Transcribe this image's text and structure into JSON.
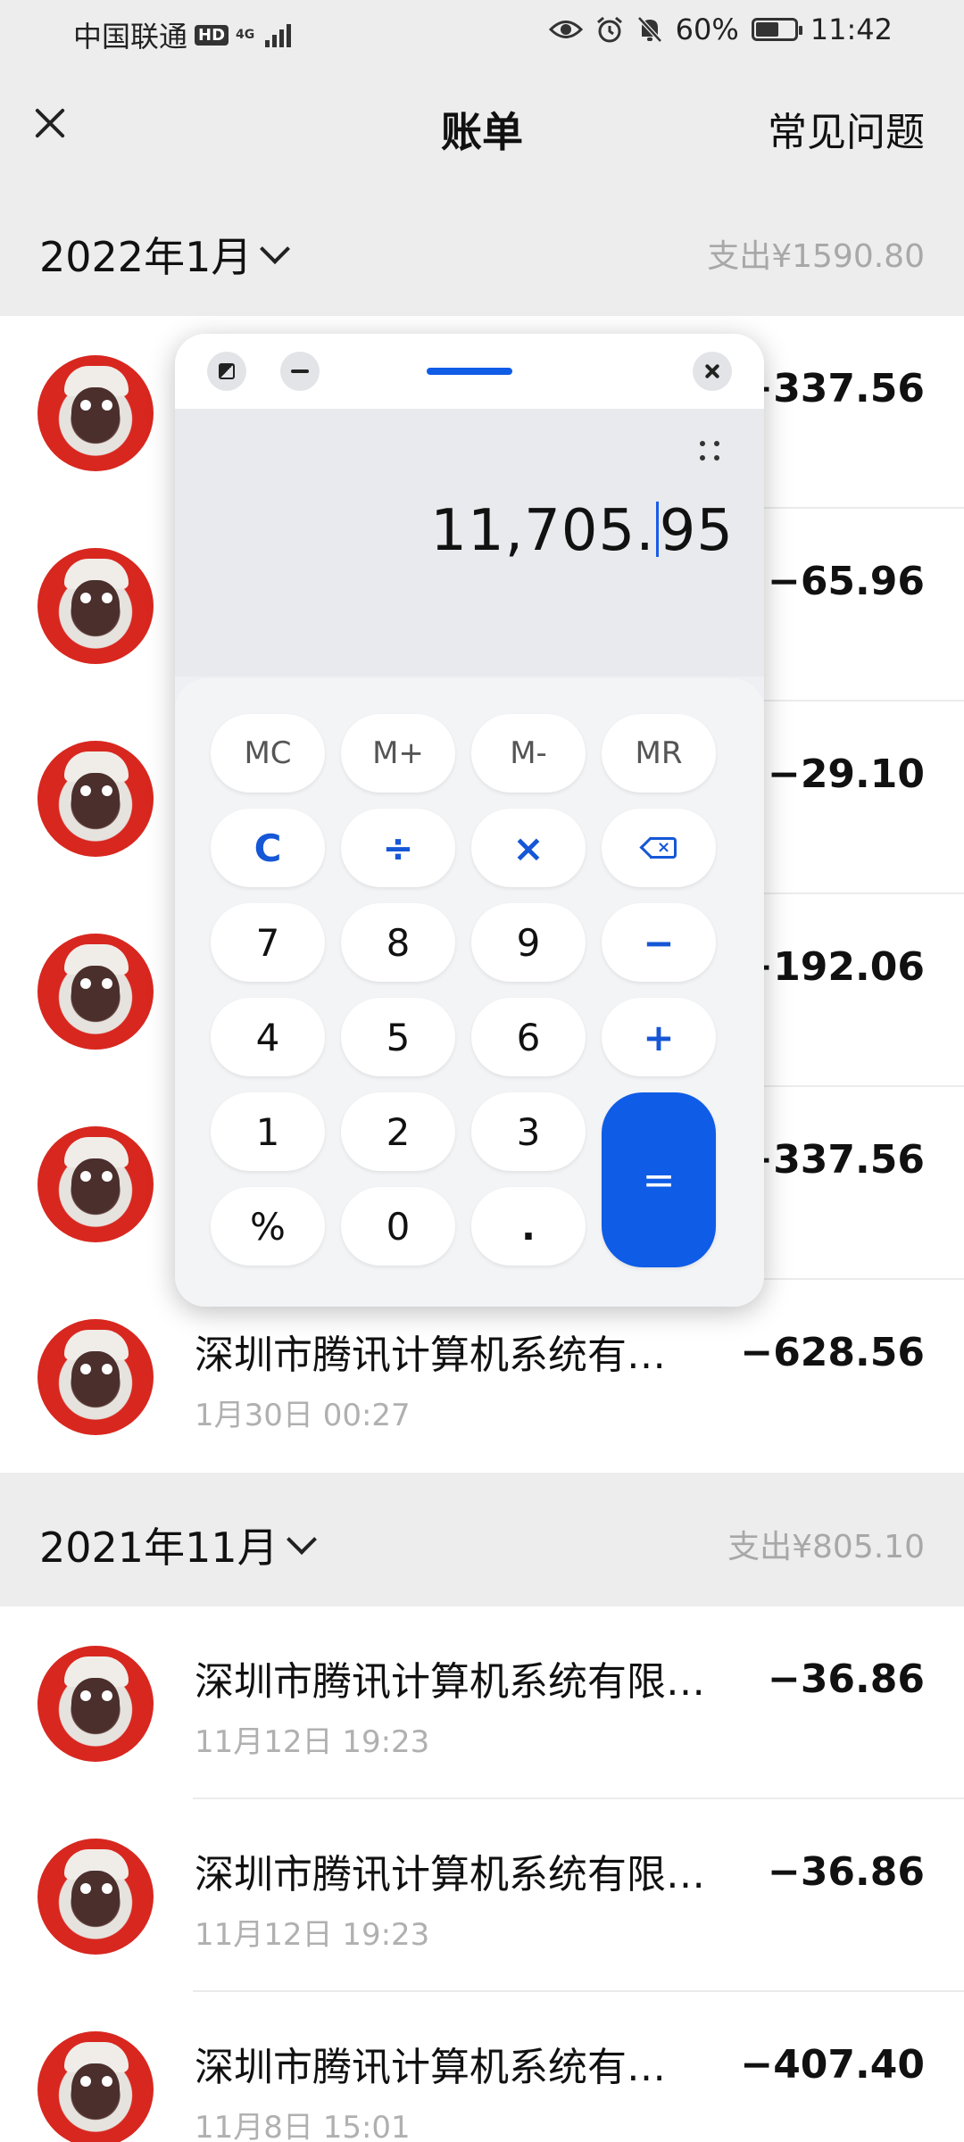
{
  "status_bar": {
    "carrier": "中国联通",
    "hd": "HD",
    "network": "4G",
    "battery": "60%",
    "battery_level": 0.6,
    "time": "11:42"
  },
  "nav": {
    "title": "账单",
    "faq": "常见问题"
  },
  "months": [
    {
      "label": "2022年1月",
      "total": "支出¥1590.80",
      "bills": [
        {
          "amount": "−337.56"
        },
        {
          "amount": "−65.96"
        },
        {
          "amount": "−29.10"
        },
        {
          "amount": "−192.06"
        },
        {
          "amount": "−337.56"
        },
        {
          "merchant": "深圳市腾讯计算机系统有…",
          "time": "1月30日 00:27",
          "amount": "−628.56"
        }
      ]
    },
    {
      "label": "2021年11月",
      "total": "支出¥805.10",
      "bills": [
        {
          "merchant": "深圳市腾讯计算机系统有限…",
          "time": "11月12日 19:23",
          "amount": "−36.86"
        },
        {
          "merchant": "深圳市腾讯计算机系统有限…",
          "time": "11月12日 19:23",
          "amount": "−36.86"
        },
        {
          "merchant": "深圳市腾讯计算机系统有…",
          "time": "11月8日 15:01",
          "amount": "−407.40"
        }
      ]
    }
  ],
  "calculator": {
    "display_before_cursor": "11,705.",
    "display_after_cursor": "95",
    "keys": {
      "mc": "MC",
      "mplus": "M+",
      "mminus": "M-",
      "mr": "MR",
      "clear": "C",
      "divide": "÷",
      "multiply": "×",
      "seven": "7",
      "eight": "8",
      "nine": "9",
      "minus": "−",
      "four": "4",
      "five": "5",
      "six": "6",
      "plus": "+",
      "one": "1",
      "two": "2",
      "three": "3",
      "equals": "=",
      "percent": "%",
      "zero": "0",
      "dot": "."
    }
  },
  "icons": {
    "close": "close-icon",
    "chevron": "chevron-down-icon",
    "eye": "eye-icon",
    "alarm": "alarm-icon",
    "mute": "bell-off-icon",
    "backspace": "backspace-icon"
  },
  "colors": {
    "accent": "#0f5ce6",
    "muted_text": "#a8a8a8",
    "header_bg": "#ededed"
  }
}
